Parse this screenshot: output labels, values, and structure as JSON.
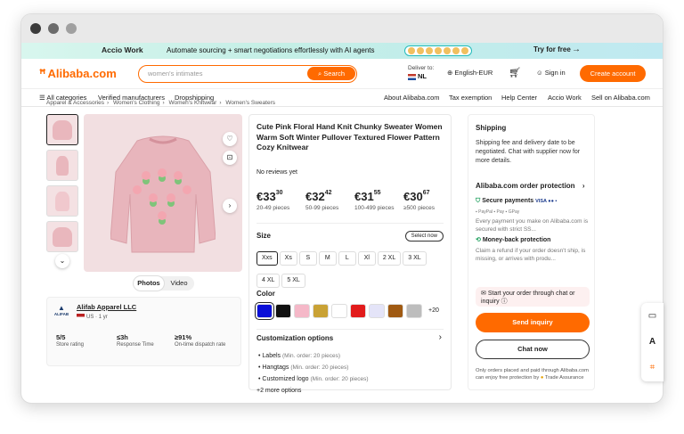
{
  "promo": {
    "brand": "Accio Work",
    "message": "Automate sourcing + smart negotiations effortlessly with AI agents",
    "cta": "Try for free",
    "arrow": "→"
  },
  "header": {
    "logo": "Alibaba.com",
    "search_placeholder": "women's intimates",
    "search_button": "Search",
    "deliver_label": "Deliver to:",
    "deliver_country": "NL",
    "language": "English-EUR",
    "sign_in": "Sign in",
    "create_account": "Create account"
  },
  "subnav": {
    "left": [
      "All categories",
      "Verified manufacturers",
      "Dropshipping"
    ],
    "right": [
      "About Alibaba.com",
      "Tax exemption",
      "Help Center",
      "Accio Work",
      "Sell on Alibaba.com"
    ]
  },
  "breadcrumbs": [
    "Apparel & Accessories",
    "Women's Clothing",
    "Women's Knitwear",
    "Women's Sweaters"
  ],
  "media_tabs": [
    "Photos",
    "Video"
  ],
  "supplier": {
    "logo_text": "ALIFAB",
    "name": "Alifab Apparel LLC",
    "country": "US",
    "years": "1 yr",
    "stats": [
      {
        "value": "5/5",
        "label": "Store rating"
      },
      {
        "value": "≤3h",
        "label": "Response Time"
      },
      {
        "value": "≥91%",
        "label": "On-time dispatch rate"
      }
    ]
  },
  "product": {
    "title": "Cute Pink Floral Hand Knit Chunky Sweater Women Warm Soft Winter Pullover Textured Flower Pattern Cozy Knitwear",
    "reviews": "No reviews yet",
    "prices": [
      {
        "main": "€33",
        "cents": "30",
        "range": "20-49 pieces"
      },
      {
        "main": "€32",
        "cents": "42",
        "range": "50-99 pieces"
      },
      {
        "main": "€31",
        "cents": "55",
        "range": "100-499 pieces"
      },
      {
        "main": "€30",
        "cents": "67",
        "range": "≥500 pieces"
      }
    ],
    "size_label": "Size",
    "select_now": "Select now",
    "sizes": [
      "Xxs",
      "Xs",
      "S",
      "M",
      "L",
      "Xl",
      "2 XL",
      "3 XL",
      "4 XL",
      "5 XL"
    ],
    "color_label": "Color",
    "colors": [
      "#0a0fd8",
      "#111111",
      "#f5b8c8",
      "#c9a235",
      "#ffffff",
      "#e21b1b",
      "#e4e4f8",
      "#a05a12",
      "#bdbdbd"
    ],
    "more_colors": "+20",
    "customization": {
      "title": "Customization options",
      "items": [
        {
          "name": "Labels",
          "note": "(Min. order: 20 pieces)"
        },
        {
          "name": "Hangtags",
          "note": "(Min. order: 20 pieces)"
        },
        {
          "name": "Customized logo",
          "note": "(Min. order: 20 pieces)"
        }
      ],
      "more": "+2 more options"
    }
  },
  "side": {
    "shipping_title": "Shipping",
    "shipping_text": "Shipping fee and delivery date to be negotiated. Chat with supplier now for more details.",
    "protection_title": "Alibaba.com order protection",
    "secure_title": "Secure payments",
    "secure_text": "Every payment you make on Alibaba.com is secured with strict SS...",
    "refund_title": "Money-back protection",
    "refund_text": "Claim a refund if your order doesn't ship, is missing, or arrives with produ...",
    "chip": "Start your order through chat or inquiry",
    "send_inquiry": "Send inquiry",
    "chat_now": "Chat now",
    "footnote": "Only orders placed and paid through Alibaba.com can enjoy free protection by",
    "trade_assurance": "Trade Assurance"
  }
}
